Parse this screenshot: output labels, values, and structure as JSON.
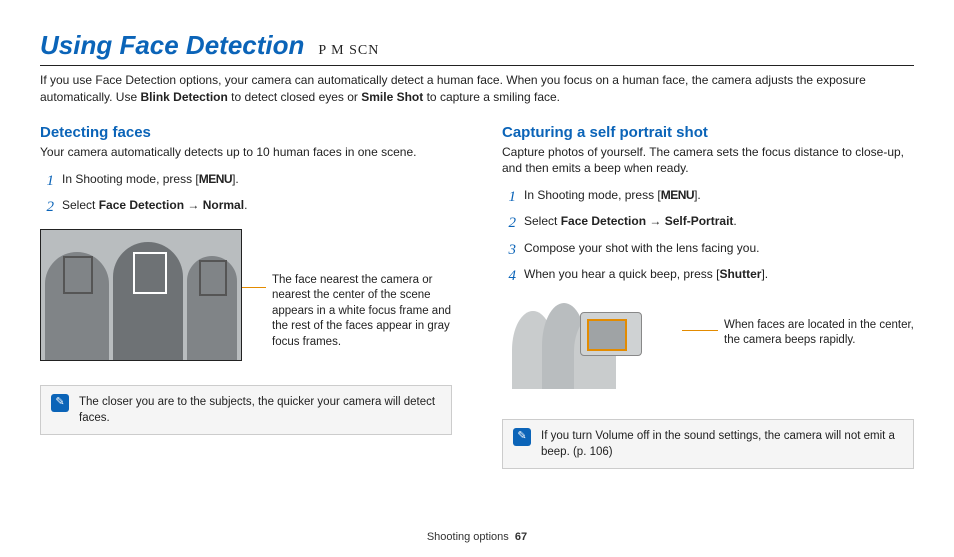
{
  "header": {
    "title": "Using Face Detection",
    "modes": "P M SCN"
  },
  "intro": {
    "part1": "If you use Face Detection options, your camera can automatically detect a human face. When you focus on a human face, the camera adjusts the exposure automatically. Use ",
    "bold1": "Blink Detection",
    "part2": " to detect closed eyes or ",
    "bold2": "Smile Shot",
    "part3": " to capture a smiling face."
  },
  "left": {
    "heading": "Detecting faces",
    "sub": "Your camera automatically detects up to 10 human faces in one scene.",
    "steps": [
      {
        "num": "1",
        "pre": "In Shooting mode, press [",
        "key": "MENU",
        "post": "]."
      },
      {
        "num": "2",
        "pre": "Select ",
        "b1": "Face Detection",
        "arrow": " → ",
        "b2": "Normal",
        "post2": "."
      }
    ],
    "callout": "The face nearest the camera or nearest the center of the scene appears in a white focus frame and the rest of the faces appear in gray focus frames.",
    "note": "The closer you are to the subjects, the quicker your camera will detect faces."
  },
  "right": {
    "heading": "Capturing a self portrait shot",
    "sub": "Capture photos of yourself. The camera sets the focus distance to close-up, and then emits a beep when ready.",
    "steps": [
      {
        "num": "1",
        "pre": "In Shooting mode, press [",
        "key": "MENU",
        "post": "]."
      },
      {
        "num": "2",
        "pre": "Select ",
        "b1": "Face Detection",
        "arrow": " → ",
        "b2": "Self-Portrait",
        "post2": "."
      },
      {
        "num": "3",
        "text": "Compose your shot with the lens facing you."
      },
      {
        "num": "4",
        "pre4": "When you hear a quick beep, press [",
        "b4": "Shutter",
        "post4": "]."
      }
    ],
    "callout": "When faces are located in the center, the camera beeps rapidly.",
    "note": "If you turn Volume off in the sound settings, the camera will not emit a beep. (p. 106)"
  },
  "footer": {
    "section": "Shooting options",
    "page": "67"
  }
}
